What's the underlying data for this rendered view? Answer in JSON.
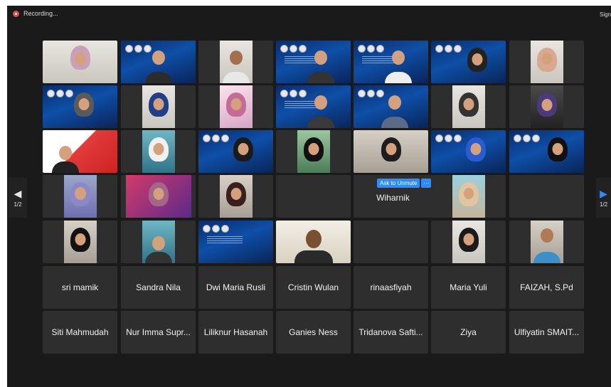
{
  "recording": {
    "label": "Recording..."
  },
  "top_right": {
    "label": "Sign"
  },
  "pager": {
    "left_label": "1/2",
    "right_label": "1/2",
    "left_icon": "chevron-left-icon",
    "right_icon": "chevron-right-icon"
  },
  "hover_controls": {
    "unmute_label": "Ask to Unmute",
    "more_label": "···"
  },
  "named_tiles": {
    "wiharnik": "Wiharnik",
    "row6": [
      "sri mamik",
      "Sandra Nila",
      "Dwi Maria Rusli",
      "Cristin Wulan",
      "rinaasfiyah",
      "Maria Yuli",
      "FAIZAH, S.Pd"
    ],
    "row7": [
      "Siti Mahmudah",
      "Nur Imma Supr...",
      "Liliknur Hasanah",
      "Ganies Ness",
      "Tridanova Safti...",
      "Ziya",
      "Ulfiyatin SMAIT..."
    ]
  },
  "colors": {
    "active_speaker": "#5ec94f",
    "unmute_button": "#2d8cff",
    "recording_dot": "#e04a4a",
    "background": "#1a1a1a",
    "tile": "#2e2e2e"
  }
}
